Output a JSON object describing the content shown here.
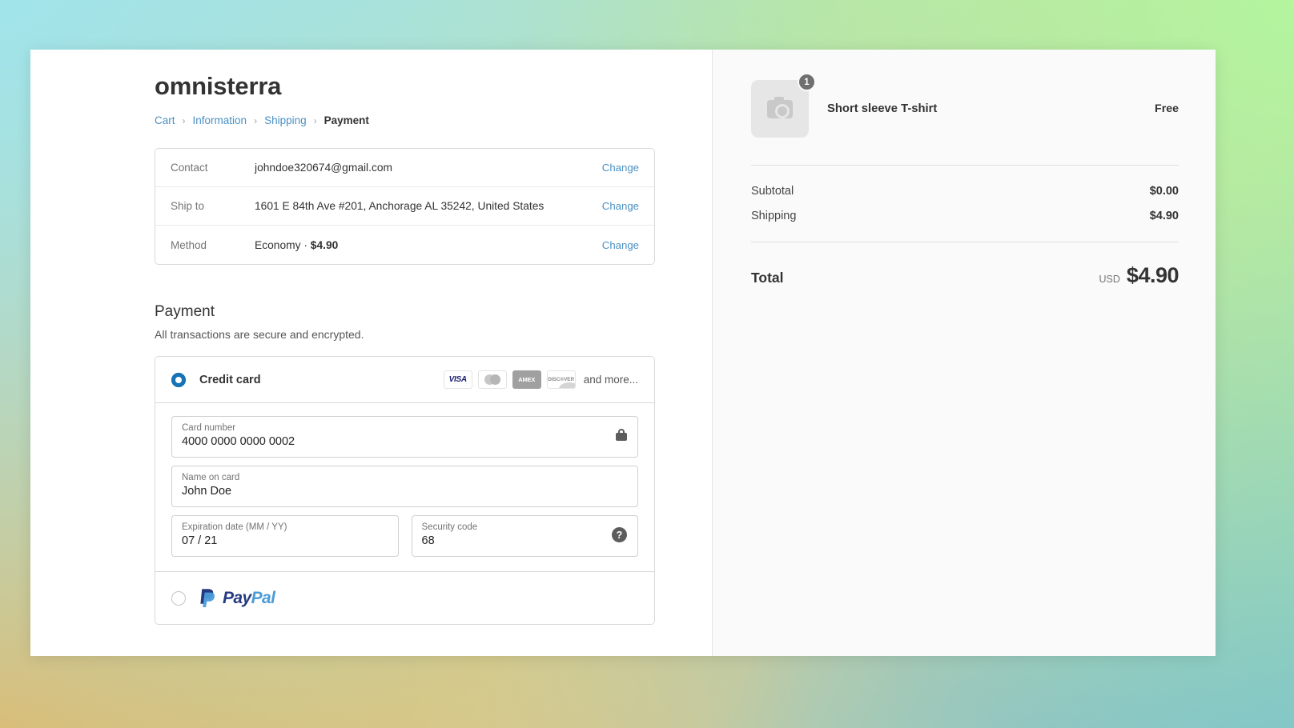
{
  "shop": {
    "title": "omnisterra"
  },
  "breadcrumb": {
    "items": [
      {
        "label": "Cart",
        "current": false
      },
      {
        "label": "Information",
        "current": false
      },
      {
        "label": "Shipping",
        "current": false
      },
      {
        "label": "Payment",
        "current": true
      }
    ],
    "separator": "›"
  },
  "review": {
    "change_label": "Change",
    "rows": [
      {
        "label": "Contact",
        "value": "johndoe320674@gmail.com"
      },
      {
        "label": "Ship to",
        "value": "1601 E 84th Ave #201, Anchorage AL 35242, United States"
      },
      {
        "label": "Method",
        "value_plain": "Economy · ",
        "value_strong": "$4.90"
      }
    ]
  },
  "payment": {
    "heading": "Payment",
    "subheading": "All transactions are secure and encrypted.",
    "credit_card": {
      "label": "Credit card",
      "selected": true,
      "brands": [
        {
          "name": "visa-logo",
          "text": "VISA"
        },
        {
          "name": "mastercard-logo",
          "text": ""
        },
        {
          "name": "amex-logo",
          "text": "AMEX"
        },
        {
          "name": "discover-logo",
          "text": "DISC®VER"
        }
      ],
      "more_label": "and more...",
      "fields": {
        "card_number": {
          "label": "Card number",
          "value": "4000 0000 0000 0002",
          "icon": "lock-icon"
        },
        "name_on_card": {
          "label": "Name on card",
          "value": "John Doe"
        },
        "expiration": {
          "label": "Expiration date (MM / YY)",
          "value": "07 / 21"
        },
        "security_code": {
          "label": "Security code",
          "value": "68",
          "icon": "help-icon",
          "icon_glyph": "?"
        }
      }
    },
    "paypal": {
      "name": "PayPal",
      "word_first": "Pay",
      "word_second": "Pal",
      "selected": false
    }
  },
  "summary": {
    "item": {
      "name": "Short sleeve T-shirt",
      "price": "Free",
      "quantity": "1",
      "thumb_icon": "camera-icon"
    },
    "lines": [
      {
        "label": "Subtotal",
        "value": "$0.00"
      },
      {
        "label": "Shipping",
        "value": "$4.90"
      }
    ],
    "total": {
      "label": "Total",
      "currency": "USD",
      "value": "$4.90"
    }
  },
  "colors": {
    "link": "#4a90c4",
    "radio_selected": "#1773b5",
    "visa_blue": "#1a1f71",
    "paypal_dark": "#253b80",
    "paypal_light": "#4a9bd8"
  }
}
